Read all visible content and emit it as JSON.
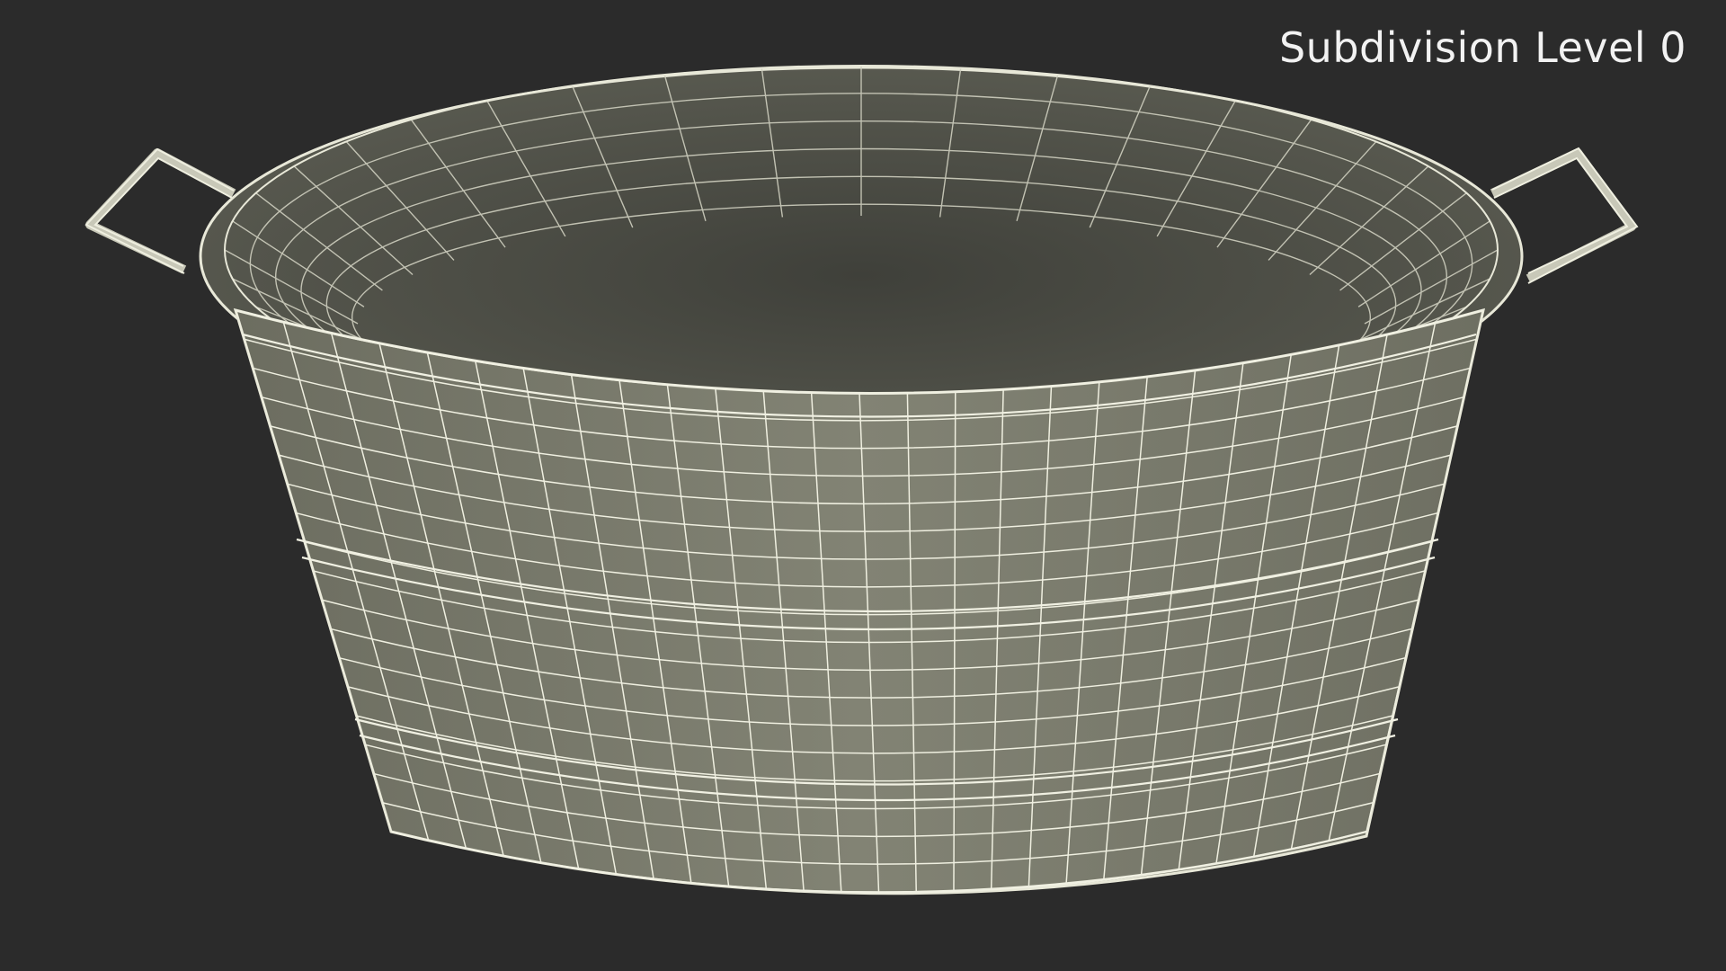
{
  "viewport": {
    "label": "Subdivision Level 0",
    "background_color": "#2b2b2b"
  },
  "model": {
    "surface_color": "#7d7e70",
    "inner_color": "#4d4e44",
    "wire_color": "#f2f2e6"
  }
}
